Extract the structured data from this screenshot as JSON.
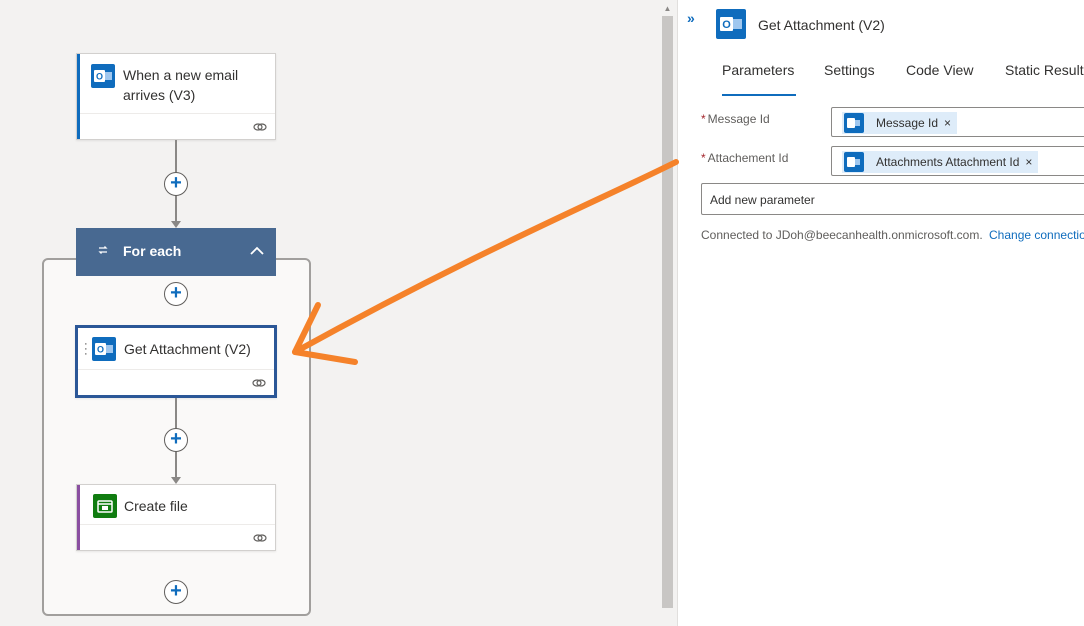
{
  "flow": {
    "trigger": {
      "title_line1": "When a new email",
      "title_line2": "arrives (V3)",
      "icon": "outlook-icon"
    },
    "foreach": {
      "label": "For each",
      "icon": "loop-icon",
      "collapse_icon": "chevron-up-icon"
    },
    "get_attachment": {
      "title": "Get Attachment (V2)",
      "icon": "outlook-icon"
    },
    "create_file": {
      "title": "Create file",
      "icon": "onedrive-icon"
    },
    "add_step_symbol": "+"
  },
  "panel": {
    "title": "Get Attachment (V2)",
    "collapse_symbol": "»",
    "tabs": [
      {
        "label": "Parameters",
        "active": true
      },
      {
        "label": "Settings",
        "active": false
      },
      {
        "label": "Code View",
        "active": false
      },
      {
        "label": "Static Result",
        "active": false
      }
    ],
    "fields": [
      {
        "label": "Message Id",
        "required_mark": "*",
        "token": "Message Id",
        "remove_symbol": "×"
      },
      {
        "label": "Attachement Id",
        "required_mark": "*",
        "token": "Attachments Attachment Id",
        "remove_symbol": "×"
      }
    ],
    "add_parameter_placeholder": "Add new parameter",
    "connected_text": "Connected to JDoh@beecanhealth.onmicrosoft.com.",
    "change_connection_text": "Change connection"
  },
  "colors": {
    "outlook_blue": "#0f6cbd",
    "onedrive_green": "#107c10",
    "foreach_header": "#486991",
    "selected_border": "#2b5797",
    "annotation_arrow": "#f5822a",
    "create_file_accent": "#8a4fa1"
  }
}
